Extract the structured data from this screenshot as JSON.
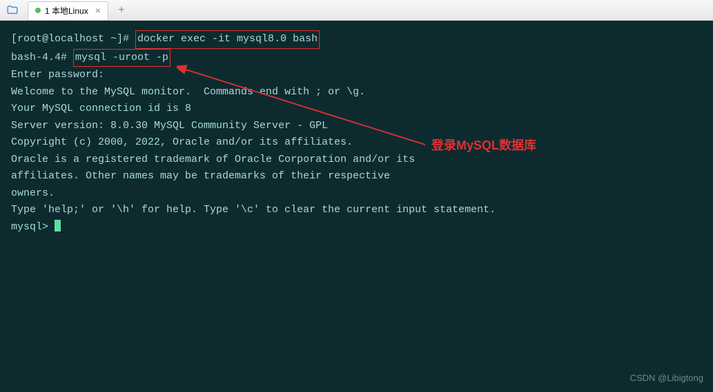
{
  "tab": {
    "label": "1 本地Linux",
    "close": "×",
    "add": "+"
  },
  "terminal": {
    "lines": {
      "prompt1": "[root@localhost ~]# ",
      "cmd1": "docker exec -it mysql8.0 bash",
      "prompt2": "bash-4.4# ",
      "cmd2": "mysql -uroot -p",
      "l3": "Enter password:",
      "l4": "Welcome to the MySQL monitor.  Commands end with ; or \\g.",
      "l5": "Your MySQL connection id is 8",
      "l6": "Server version: 8.0.30 MySQL Community Server - GPL",
      "l7": "",
      "l8": "Copyright (c) 2000, 2022, Oracle and/or its affiliates.",
      "l9": "",
      "l10": "Oracle is a registered trademark of Oracle Corporation and/or its",
      "l11": "affiliates. Other names may be trademarks of their respective",
      "l12": "owners.",
      "l13": "",
      "l14": "Type 'help;' or '\\h' for help. Type '\\c' to clear the current input statement.",
      "l15": "",
      "prompt3": "mysql> "
    }
  },
  "annotation": {
    "text": "登录MySQL数据库"
  },
  "watermark": "CSDN @Libigtong"
}
